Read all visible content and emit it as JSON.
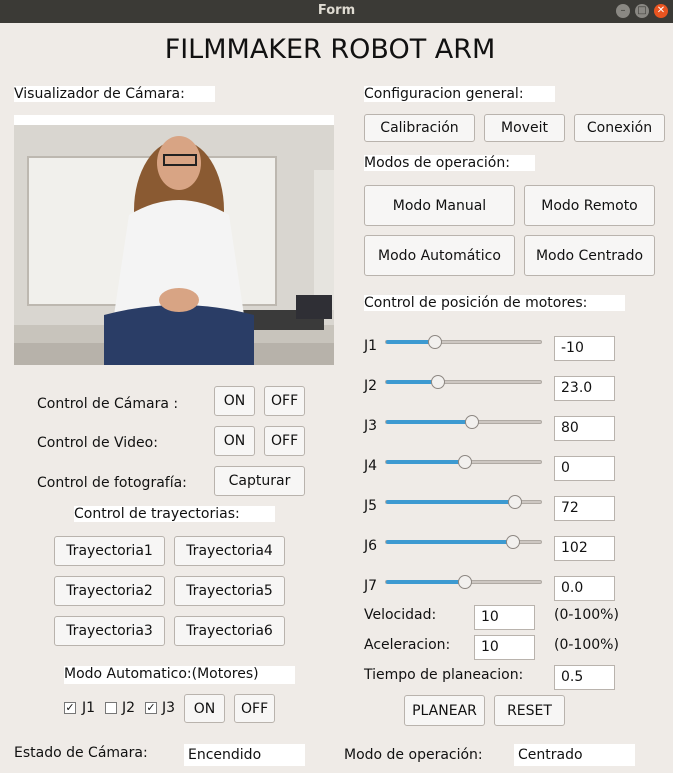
{
  "window": {
    "title": "Form"
  },
  "app_title": "FILMMAKER ROBOT ARM",
  "camera_panel": {
    "label": "Visualizador de Cámara:"
  },
  "camera_controls": [
    {
      "label": "Control de Cámara :",
      "on": "ON",
      "off": "OFF"
    },
    {
      "label": "Control de Video:",
      "on": "ON",
      "off": "OFF"
    }
  ],
  "photo": {
    "label": "Control de fotografía:",
    "button": "Capturar"
  },
  "trajectories": {
    "label": "Control de trayectorias:",
    "buttons": [
      "Trayectoria1",
      "Trayectoria4",
      "Trayectoria2",
      "Trayectoria5",
      "Trayectoria3",
      "Trayectoria6"
    ]
  },
  "auto_mode": {
    "label": "Modo Automatico:(Motores)",
    "checks": [
      {
        "label": "J1",
        "checked": true
      },
      {
        "label": "J2",
        "checked": false
      },
      {
        "label": "J3",
        "checked": true
      }
    ],
    "on": "ON",
    "off": "OFF"
  },
  "general": {
    "label": "Configuracion general:",
    "buttons": [
      "Calibración",
      "Moveit",
      "Conexión"
    ]
  },
  "modes": {
    "label": "Modos de operación:",
    "buttons": [
      "Modo Manual",
      "Modo Remoto",
      "Modo Automático",
      "Modo Centrado"
    ]
  },
  "motors": {
    "label": "Control de posición de motores:",
    "joints": [
      {
        "name": "J1",
        "value": "-10",
        "level": 0.31
      },
      {
        "name": "J2",
        "value": "23.0",
        "level": 0.33
      },
      {
        "name": "J3",
        "value": "80",
        "level": 0.55
      },
      {
        "name": "J4",
        "value": "0",
        "level": 0.5
      },
      {
        "name": "J5",
        "value": "72",
        "level": 0.82
      },
      {
        "name": "J6",
        "value": "102",
        "level": 0.81
      },
      {
        "name": "J7",
        "value": "0.0",
        "level": 0.5
      }
    ]
  },
  "velocity": {
    "label": "Velocidad:",
    "value": "10",
    "range": "(0-100%)"
  },
  "acceleration": {
    "label": "Aceleracion:",
    "value": "10",
    "range": "(0-100%)"
  },
  "planning_time": {
    "label": "Tiempo de planeacion:",
    "value": "0.5"
  },
  "actions": {
    "plan": "PLANEAR",
    "reset": "RESET"
  },
  "status": {
    "camera_label": "Estado de  Cámara:",
    "camera_value": "Encendido",
    "mode_label": "Modo de operación:",
    "mode_value": "Centrado"
  },
  "colors": {
    "titlebar": "#3b3a36",
    "close": "#e95420",
    "slider_fill": "#3d9ad1",
    "background": "#efebe7"
  }
}
